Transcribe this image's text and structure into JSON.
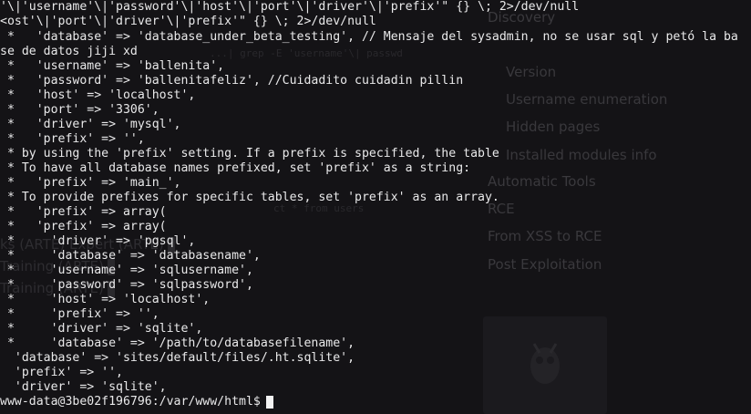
{
  "background_ui": {
    "menu": [
      {
        "label": "Discovery",
        "level": 1
      },
      {
        "label": "Version",
        "level": 2
      },
      {
        "label": "Username enumeration",
        "level": 2
      },
      {
        "label": "Hidden pages",
        "level": 2
      },
      {
        "label": "Installed modules info",
        "level": 2
      },
      {
        "label": "Automatic Tools",
        "level": 1
      },
      {
        "label": "RCE",
        "level": 1
      },
      {
        "label": "From XSS to RCE",
        "level": 1
      },
      {
        "label": "Post Exploitation",
        "level": 1
      }
    ],
    "course_links": [
      "ks (ARTE) Expert (ARTE)",
      "Training (ARTE)",
      "Training (ARTE)"
    ],
    "code_snippet": "...| grep -E 'username'\\| passwd",
    "code_snippet_2": "ct * from users"
  },
  "terminal": {
    "lines": [
      "'\\|'username'\\|'password'\\|'host'\\|'port'\\|'driver'\\|'prefix'\" {} \\; 2>/dev/null",
      "<ost'\\|'port'\\|'driver'\\|'prefix'\" {} \\; 2>/dev/null",
      " *   'database' => 'database_under_beta_testing', // Mensaje del sysadmin, no se usar sql y petó la ba",
      "se de datos jiji xd",
      " *   'username' => 'ballenita',",
      " *   'password' => 'ballenitafeliz', //Cuidadito cuidadin pillin",
      " *   'host' => 'localhost',",
      " *   'port' => '3306',",
      " *   'driver' => 'mysql',",
      " *   'prefix' => '',",
      " * by using the 'prefix' setting. If a prefix is specified, the table",
      " * To have all database names prefixed, set 'prefix' as a string:",
      " *   'prefix' => 'main_',",
      " * To provide prefixes for specific tables, set 'prefix' as an array.",
      " *   'prefix' => array(",
      " *   'prefix' => array(",
      " *     'driver' => 'pgsql',",
      " *     'database' => 'databasename',",
      " *     'username' => 'sqlusername',",
      " *     'password' => 'sqlpassword',",
      " *     'host' => 'localhost',",
      " *     'prefix' => '',",
      " *     'driver' => 'sqlite',",
      " *     'database' => '/path/to/databasefilename',",
      "  'database' => 'sites/default/files/.ht.sqlite',",
      "  'prefix' => '',",
      "  'driver' => 'sqlite',"
    ],
    "prompt": "www-data@3be02f196796:/var/www/html$"
  }
}
